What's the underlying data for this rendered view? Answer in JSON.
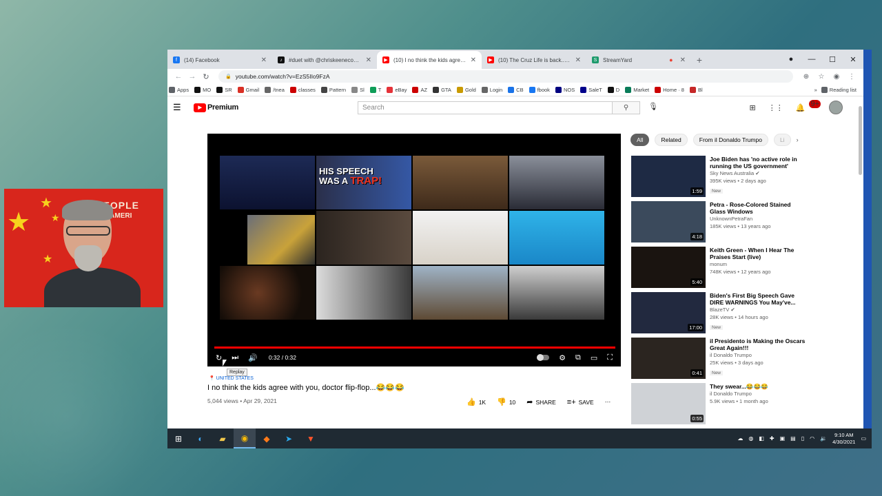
{
  "browser": {
    "tabs": [
      {
        "title": "(14) Facebook",
        "color": "#1877f2",
        "icon": "facebook-icon"
      },
      {
        "title": "#duet with @chriskeenecomedy",
        "color": "#111111",
        "icon": "tiktok-icon"
      },
      {
        "title": "(10) I no think the kids agree with",
        "color": "#ff0000",
        "icon": "youtube-icon"
      },
      {
        "title": "(10) The Cruz Life is back... - You",
        "color": "#ff0000",
        "icon": "youtube-icon"
      },
      {
        "title": "StreamYard",
        "color": "#1d9a6c",
        "icon": "streamyard-icon"
      }
    ],
    "url": "youtube.com/watch?v=EzS5IIo9FzA",
    "bookmarks": [
      {
        "label": "Apps",
        "color": "#5f6368"
      },
      {
        "label": "MO",
        "color": "#111111"
      },
      {
        "label": "SR",
        "color": "#111111"
      },
      {
        "label": "Gmail",
        "color": "#d93025"
      },
      {
        "label": "/tnea",
        "color": "#666666"
      },
      {
        "label": "classes",
        "color": "#cc0000"
      },
      {
        "label": "Pattern",
        "color": "#444444"
      },
      {
        "label": "Sl",
        "color": "#888888"
      },
      {
        "label": "T",
        "color": "#0f9d58"
      },
      {
        "label": "eBay",
        "color": "#e53238"
      },
      {
        "label": "AZ",
        "color": "#cc0000"
      },
      {
        "label": "GTA",
        "color": "#333333"
      },
      {
        "label": "Gold",
        "color": "#c99a00"
      },
      {
        "label": "Login",
        "color": "#666666"
      },
      {
        "label": "CB",
        "color": "#1a73e8"
      },
      {
        "label": "fbook",
        "color": "#1877f2"
      },
      {
        "label": "NOS",
        "color": "#000080"
      },
      {
        "label": "SaleT",
        "color": "#00008b"
      },
      {
        "label": "D",
        "color": "#111111"
      },
      {
        "label": "Market",
        "color": "#0a7c59"
      },
      {
        "label": "Home · 8",
        "color": "#cc0000"
      },
      {
        "label": "Bl",
        "color": "#c62828"
      }
    ],
    "reading_list": "Reading list"
  },
  "youtube": {
    "logo": "Premium",
    "search_placeholder": "Search",
    "notif_count": "9+",
    "video": {
      "time": "0:32 / 0:32",
      "tooltip": "Replay",
      "location": "UNITED STATES",
      "title": "I no think the kids agree with you, doctor flip-flop...😂😂😂",
      "meta": "5,044 views • Apr 29, 2021",
      "likes": "1K",
      "dislikes": "10",
      "share": "SHARE",
      "save": "SAVE",
      "thumb_caption_1": "HIS SPEECH",
      "thumb_caption_2": "WAS A",
      "thumb_caption_3": "TRAP!"
    },
    "chips": [
      "All",
      "Related",
      "From il Donaldo Trumpo",
      "Li"
    ],
    "recommendations": [
      {
        "title": "Joe Biden has 'no active role in running the US government'",
        "channel": "Sky News Australia ✔",
        "meta": "395K views • 2 days ago",
        "badge": "New",
        "duration": "1:59",
        "bg": "#1e2a44"
      },
      {
        "title": "Petra - Rose-Colored Stained Glass Windows",
        "channel": "UnknownPetraFan",
        "meta": "185K views • 13 years ago",
        "badge": "",
        "duration": "4:18",
        "bg": "#3b4a5c"
      },
      {
        "title": "Keith Green - When I Hear The Praises Start (live)",
        "channel": "monum",
        "meta": "748K views • 12 years ago",
        "badge": "",
        "duration": "5:40",
        "bg": "#1a1410"
      },
      {
        "title": "Biden's First Big Speech Gave DIRE WARNINGS You May've...",
        "channel": "BlazeTV ✔",
        "meta": "28K views • 14 hours ago",
        "badge": "New",
        "duration": "17:00",
        "bg": "#22293f"
      },
      {
        "title": "il Presidento is Making the Oscars Great Again!!!",
        "channel": "il Donaldo Trumpo",
        "meta": "25K views • 3 days ago",
        "badge": "New",
        "duration": "0:41",
        "bg": "#2b2520"
      },
      {
        "title": "They swear...😂😂😂",
        "channel": "il Donaldo Trumpo",
        "meta": "5.9K views • 1 month ago",
        "badge": "",
        "duration": "0:55",
        "bg": "#cfd2d6"
      }
    ]
  },
  "webcam": {
    "banner_line1": "E PEOPLE",
    "banner_line2": "LIC OF AMERI"
  },
  "taskbar": {
    "time": "9:10 AM",
    "date": "4/30/2021"
  }
}
